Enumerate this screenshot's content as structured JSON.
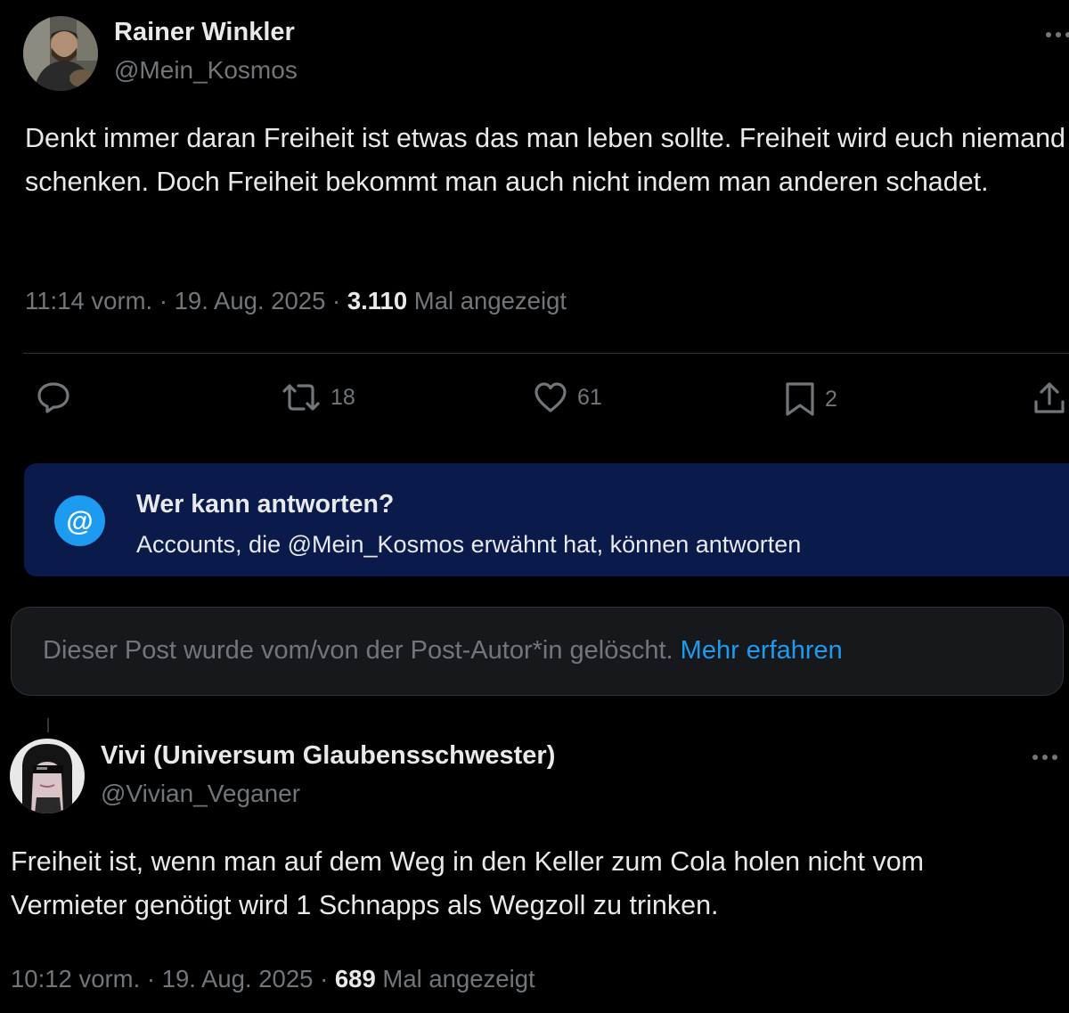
{
  "post": {
    "author_name": "Rainer Winkler",
    "author_handle": "@Mein_Kosmos",
    "text": "Denkt immer daran Freiheit ist etwas das man leben sollte. Freiheit wird euch niemand schenken. Doch Freiheit bekommt man auch nicht indem man anderen schadet.",
    "time": "11:14 vorm.",
    "date": "19. Aug. 2025",
    "views_count": "3.110",
    "views_label": "Mal angezeigt",
    "separator": "·",
    "actions": {
      "reply_icon": "reply-icon",
      "repost_icon": "repost-icon",
      "repost_count": "18",
      "like_icon": "heart-icon",
      "like_count": "61",
      "bookmark_icon": "bookmark-icon",
      "bookmark_count": "2",
      "share_icon": "share-icon"
    }
  },
  "reply_restriction": {
    "icon": "@",
    "title": "Wer kann antworten?",
    "subtitle": "Accounts, die @Mein_Kosmos erwähnt hat, können antworten"
  },
  "deleted_notice": {
    "text": "Dieser Post wurde vom/von der Post-Autor*in gelöscht.",
    "link": "Mehr erfahren"
  },
  "reply": {
    "author_name": "Vivi (Universum Glaubensschwester)",
    "author_handle": "@Vivian_Veganer",
    "text": "Freiheit ist, wenn man auf dem Weg in den Keller zum Cola holen nicht vom Vermieter genötigt wird 1 Schnapps als Wegzoll zu trinken.",
    "time": "10:12 vorm.",
    "date": "19. Aug. 2025",
    "views_count": "689",
    "views_label": "Mal angezeigt",
    "separator": "·"
  },
  "colors": {
    "background": "#000000",
    "text": "#e7e9ea",
    "muted": "#71767b",
    "accent": "#1d9bf0",
    "info_box": "#0a1a4a",
    "deleted_box": "#16181c"
  }
}
